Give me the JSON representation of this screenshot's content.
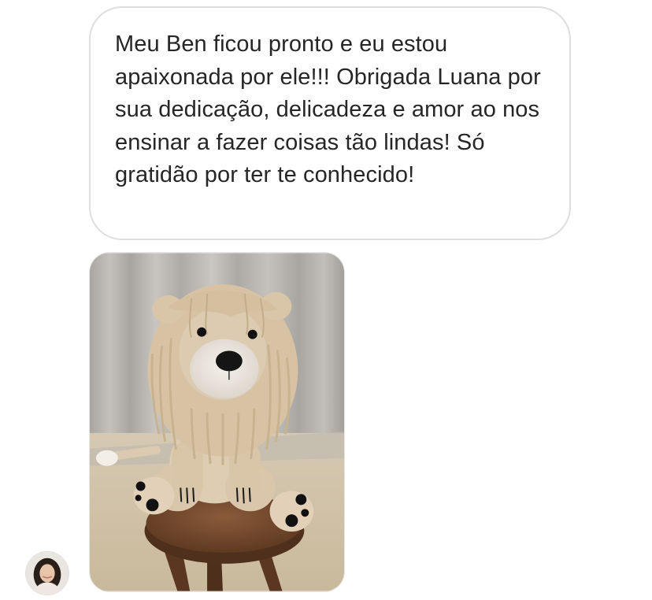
{
  "conversation": {
    "message": {
      "text": "Meu Ben ficou pronto e eu estou apaixonada por ele!!! Obrigada Luana por sua dedicação, delicadeza e amor ao nos ensinar a fazer coisas tão lindas! Só gratidão por ter te conhecido!"
    },
    "photo": {
      "icon": "crochet-lion-photo"
    },
    "sender": {
      "avatar_icon": "user-avatar"
    }
  },
  "colors": {
    "bubble_border": "#dedede",
    "bubble_text": "#262626",
    "background": "#ffffff"
  }
}
